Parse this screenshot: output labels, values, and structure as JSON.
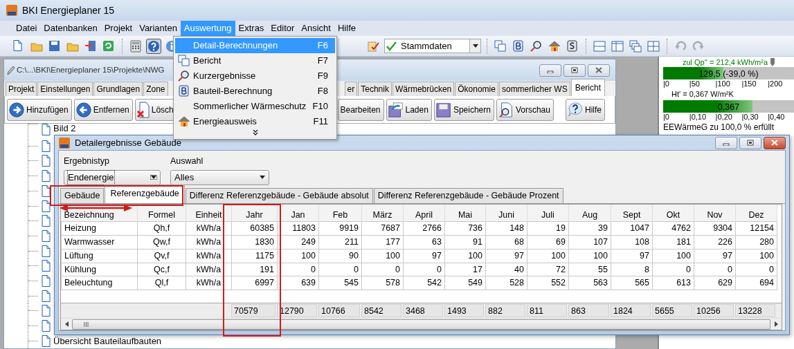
{
  "app": {
    "title": "BKI Energieplaner 15"
  },
  "menu": [
    {
      "label": "Datei",
      "selected": false
    },
    {
      "label": "Datenbanken",
      "selected": false
    },
    {
      "label": "Projekt",
      "selected": false
    },
    {
      "label": "Varianten",
      "selected": false
    },
    {
      "label": "Auswertung",
      "selected": true
    },
    {
      "label": "Extras",
      "selected": false
    },
    {
      "label": "Editor",
      "selected": false
    },
    {
      "label": "Ansicht",
      "selected": false
    },
    {
      "label": "Hilfe",
      "selected": false
    }
  ],
  "toolbar": {
    "help_pressed": true,
    "combo": "Stammdaten"
  },
  "dropdown": [
    {
      "label": "Detail-Berechnungen",
      "shortcut": "F6",
      "selected": true,
      "kind": "plain"
    },
    {
      "label": "Bericht",
      "shortcut": "F7",
      "selected": false,
      "kind": "pages"
    },
    {
      "label": "Kurzergebnisse",
      "shortcut": "F9",
      "selected": false,
      "kind": "magnifier"
    },
    {
      "label": "Bauteil-Berechnung",
      "shortcut": "F8",
      "selected": false,
      "kind": "letter"
    },
    {
      "label": "Sommerlicher Wärmeschutz",
      "shortcut": "F10",
      "selected": false,
      "kind": "plain"
    },
    {
      "label": "Energieausweis",
      "shortcut": "F11",
      "selected": false,
      "kind": "house"
    }
  ],
  "project_window": {
    "title": "C:\\...\\BKI\\Energieplaner 15\\Projekte\\NWG",
    "tabs_left": [
      {
        "label": "Projekt",
        "selected": false
      },
      {
        "label": "Einstellungen",
        "selected": false
      },
      {
        "label": "Grundlagen",
        "selected": false
      },
      {
        "label": "Zone",
        "selected": false
      }
    ],
    "tabs_right": [
      {
        "label": "er",
        "selected": false
      },
      {
        "label": "Technik",
        "selected": false
      },
      {
        "label": "Wärmebrücken",
        "selected": false
      },
      {
        "label": "Ökonomie",
        "selected": false
      },
      {
        "label": "sommerlicher WS",
        "selected": false
      },
      {
        "label": "Bericht",
        "selected": true
      }
    ],
    "buttons_left": [
      {
        "label": "Hinzufügen",
        "kind": "forward"
      },
      {
        "label": "Entfernen",
        "kind": "back"
      },
      {
        "label": "Lösch",
        "kind": "delete"
      }
    ],
    "buttons_right": [
      {
        "label": "Bearbeiten",
        "kind": "plain"
      },
      {
        "label": "Laden",
        "kind": "load"
      },
      {
        "label": "Speichern",
        "kind": "save"
      },
      {
        "label": "Vorschau",
        "kind": "preview"
      },
      {
        "label": "Hilfe",
        "kind": "help"
      }
    ],
    "tree": {
      "top_item": "Bild 2",
      "bottom_item": "Übersicht Bauteilaufbauten"
    }
  },
  "indicators": [
    {
      "caption": "zul Qp'' = 212,4 kWh/m²a",
      "color": "#008000",
      "value": "129,5 (-39,0 %)",
      "level": 0.46,
      "ticks": [
        "|0",
        "|50",
        "|100",
        "|150",
        "|200"
      ]
    },
    {
      "caption": "Ht' = 0,367 W/m²K",
      "color": "#000000",
      "value": "0,367",
      "level": 0.68,
      "ticks": [
        "|0",
        "|0,10",
        "|0,20",
        "|0,30",
        "|0,40"
      ]
    }
  ],
  "status_text": "EEWärmeG zu 100,0 % erfüllt",
  "dialog": {
    "title": "Detailergebnisse Gebäude",
    "result_type": {
      "label": "Ergebnistyp",
      "value": "Endenergie"
    },
    "selection": {
      "label": "Auswahl",
      "value": "Alles"
    },
    "tabs": [
      {
        "label": "Gebäude",
        "selected": false
      },
      {
        "label": "Referenzgebäude",
        "selected": true
      },
      {
        "label": "Differenz Referenzgebäude - Gebäude absolut",
        "selected": false
      },
      {
        "label": "Differenz Referenzgebäude - Gebäude Prozent",
        "selected": false
      }
    ],
    "columns": [
      "Bezeichnung",
      "Formel",
      "Einheit",
      "Jahr",
      "Jan",
      "Feb",
      "März",
      "April",
      "Mai",
      "Juni",
      "Juli",
      "Aug",
      "Sept",
      "Okt",
      "Nov",
      "Dez"
    ],
    "rows": [
      [
        "Heizung",
        "Qh,f",
        "kWh/a",
        "60385",
        "11803",
        "9919",
        "7687",
        "2766",
        "736",
        "148",
        "19",
        "39",
        "1047",
        "4762",
        "9304",
        "12154"
      ],
      [
        "Warmwasser",
        "Qw,f",
        "kWh/a",
        "1830",
        "249",
        "211",
        "177",
        "63",
        "91",
        "68",
        "69",
        "107",
        "108",
        "181",
        "226",
        "280"
      ],
      [
        "Lüftung",
        "Qv,f",
        "kWh/a",
        "1175",
        "100",
        "90",
        "100",
        "97",
        "100",
        "97",
        "100",
        "100",
        "97",
        "100",
        "97",
        "100"
      ],
      [
        "Kühlung",
        "Qc,f",
        "kWh/a",
        "191",
        "0",
        "0",
        "0",
        "0",
        "17",
        "40",
        "72",
        "55",
        "8",
        "0",
        "0",
        "0"
      ],
      [
        "Beleuchtung",
        "Ql,f",
        "kWh/a",
        "6997",
        "639",
        "545",
        "578",
        "542",
        "549",
        "528",
        "552",
        "563",
        "565",
        "613",
        "629",
        "694"
      ]
    ],
    "totals": [
      "70579",
      "12790",
      "10766",
      "8542",
      "3468",
      "1493",
      "882",
      "811",
      "863",
      "1824",
      "5655",
      "10256",
      "13228"
    ]
  }
}
